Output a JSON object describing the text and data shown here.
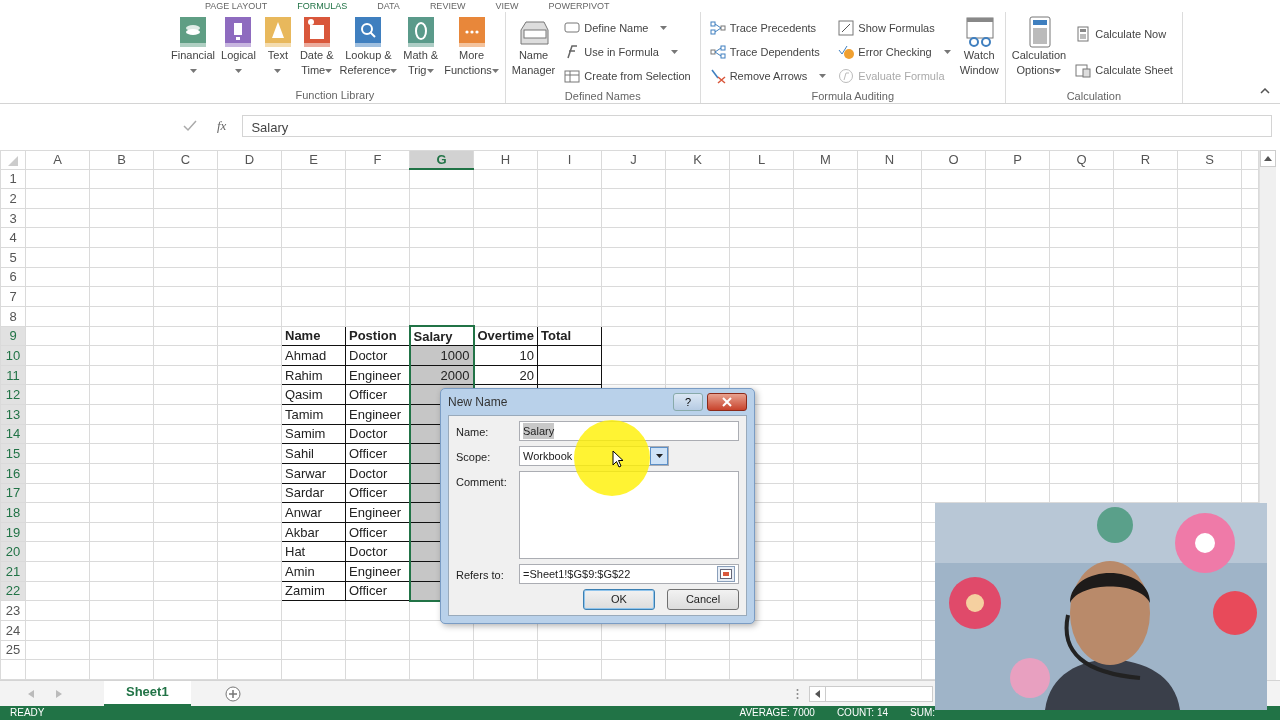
{
  "ribbon_tabs": [
    {
      "label": "PAGE LAYOUT",
      "selected": false
    },
    {
      "label": "FORMULAS",
      "selected": true
    },
    {
      "label": "DATA",
      "selected": false
    },
    {
      "label": "REVIEW",
      "selected": false
    },
    {
      "label": "VIEW",
      "selected": false
    },
    {
      "label": "POWERPIVOT",
      "selected": false
    }
  ],
  "ribbon_groups": [
    {
      "title": "Function Library",
      "items": [
        {
          "kind": "large",
          "label": "Financial",
          "dropdown": true,
          "disabled": false
        },
        {
          "kind": "large",
          "label": "Logical",
          "dropdown": true,
          "disabled": false
        },
        {
          "kind": "large",
          "label": "Text",
          "dropdown": true,
          "disabled": false
        },
        {
          "kind": "large",
          "label": "Date &\nTime",
          "dropdown": true,
          "disabled": false
        },
        {
          "kind": "large",
          "label": "Lookup &\nReference",
          "dropdown": true,
          "disabled": false
        },
        {
          "kind": "large",
          "label": "Math &\nTrig",
          "dropdown": true,
          "disabled": false
        },
        {
          "kind": "large",
          "label": "More\nFunctions",
          "dropdown": true,
          "disabled": false
        }
      ]
    },
    {
      "title": "Defined Names",
      "items": [
        {
          "kind": "large",
          "label": "Name\nManager",
          "dropdown": false,
          "disabled": false
        },
        {
          "kind": "small",
          "label": "Define Name",
          "dropdown": true,
          "disabled": false
        },
        {
          "kind": "small",
          "label": "Use in Formula",
          "dropdown": true,
          "disabled": false
        },
        {
          "kind": "small",
          "label": "Create from Selection",
          "dropdown": false,
          "disabled": false
        }
      ]
    },
    {
      "title": "Formula Auditing",
      "items": [
        {
          "kind": "small",
          "label": "Trace Precedents",
          "dropdown": false,
          "disabled": false
        },
        {
          "kind": "small",
          "label": "Trace Dependents",
          "dropdown": false,
          "disabled": false
        },
        {
          "kind": "small",
          "label": "Remove Arrows",
          "dropdown": true,
          "disabled": false
        },
        {
          "kind": "small",
          "label": "Show Formulas",
          "dropdown": false,
          "disabled": false
        },
        {
          "kind": "small",
          "label": "Error Checking",
          "dropdown": true,
          "disabled": false
        },
        {
          "kind": "small",
          "label": "Evaluate Formula",
          "dropdown": false,
          "disabled": true
        },
        {
          "kind": "large",
          "label": "Watch\nWindow",
          "dropdown": false,
          "disabled": false
        }
      ]
    },
    {
      "title": "Calculation",
      "items": [
        {
          "kind": "large",
          "label": "Calculation\nOptions",
          "dropdown": true,
          "disabled": false
        },
        {
          "kind": "small",
          "label": "Calculate Now",
          "dropdown": false,
          "disabled": false
        },
        {
          "kind": "small",
          "label": "Calculate Sheet",
          "dropdown": false,
          "disabled": false
        }
      ]
    }
  ],
  "formula_bar": {
    "insert_function": "fx",
    "value": "Salary"
  },
  "grid": {
    "columns": [
      {
        "label": "A",
        "selected": false
      },
      {
        "label": "B",
        "selected": false
      },
      {
        "label": "C",
        "selected": false
      },
      {
        "label": "D",
        "selected": false
      },
      {
        "label": "E",
        "selected": false
      },
      {
        "label": "F",
        "selected": false
      },
      {
        "label": "G",
        "selected": true
      },
      {
        "label": "H",
        "selected": false
      },
      {
        "label": "I",
        "selected": false
      },
      {
        "label": "J",
        "selected": false
      },
      {
        "label": "K",
        "selected": false
      },
      {
        "label": "L",
        "selected": false
      },
      {
        "label": "M",
        "selected": false
      },
      {
        "label": "N",
        "selected": false
      },
      {
        "label": "O",
        "selected": false
      },
      {
        "label": "P",
        "selected": false
      },
      {
        "label": "Q",
        "selected": false
      },
      {
        "label": "R",
        "selected": false
      },
      {
        "label": "S",
        "selected": false
      }
    ],
    "rows": [
      {
        "label": "1",
        "selected": false
      },
      {
        "label": "2",
        "selected": false
      },
      {
        "label": "3",
        "selected": false
      },
      {
        "label": "4",
        "selected": false
      },
      {
        "label": "5",
        "selected": false
      },
      {
        "label": "6",
        "selected": false
      },
      {
        "label": "7",
        "selected": false
      },
      {
        "label": "8",
        "selected": false
      },
      {
        "label": "9",
        "selected": true
      },
      {
        "label": "10",
        "selected": true
      },
      {
        "label": "11",
        "selected": true
      },
      {
        "label": "12",
        "selected": true
      },
      {
        "label": "13",
        "selected": true
      },
      {
        "label": "14",
        "selected": true
      },
      {
        "label": "15",
        "selected": true
      },
      {
        "label": "16",
        "selected": true
      },
      {
        "label": "17",
        "selected": true
      },
      {
        "label": "18",
        "selected": true
      },
      {
        "label": "19",
        "selected": true
      },
      {
        "label": "20",
        "selected": true
      },
      {
        "label": "21",
        "selected": true
      },
      {
        "label": "22",
        "selected": true
      },
      {
        "label": "23",
        "selected": false
      },
      {
        "label": "24",
        "selected": false
      },
      {
        "label": "25",
        "selected": false
      }
    ]
  },
  "table": {
    "header": [
      "Name",
      "Postion",
      "Salary",
      "Overtime",
      "Total"
    ],
    "rows": [
      [
        "Ahmad",
        "Doctor",
        "1000",
        "10",
        null
      ],
      [
        "Rahim",
        "Engineer",
        "2000",
        "20",
        null
      ],
      [
        "Qasim",
        "Officer",
        null,
        null,
        null
      ],
      [
        "Tamim",
        "Engineer",
        null,
        null,
        null
      ],
      [
        "Samim",
        "Doctor",
        null,
        null,
        null
      ],
      [
        "Sahil",
        "Officer",
        null,
        null,
        null
      ],
      [
        "Sarwar",
        "Doctor",
        null,
        null,
        null
      ],
      [
        "Sardar",
        "Officer",
        null,
        null,
        null
      ],
      [
        "Anwar",
        "Engineer",
        null,
        null,
        null
      ],
      [
        "Akbar",
        "Officer",
        null,
        null,
        null
      ],
      [
        "Hat",
        "Doctor",
        null,
        null,
        null
      ],
      [
        "Amin",
        "Engineer",
        null,
        null,
        null
      ],
      [
        "Zamim",
        "Officer",
        null,
        null,
        null
      ]
    ]
  },
  "sheet_tabs": [
    {
      "label": "Sheet1",
      "selected": true
    }
  ],
  "status_bar": {
    "mode": "READY",
    "stats": [
      "AVERAGE: 7000",
      "COUNT: 14",
      "SUM:"
    ]
  },
  "dialog": {
    "title": "New Name",
    "help": "?",
    "fields": [
      {
        "kind": "text",
        "label": "Name:",
        "value": "Salary"
      },
      {
        "kind": "select",
        "label": "Scope:",
        "value": "Workbook"
      },
      {
        "kind": "textarea",
        "label": "Comment:"
      },
      {
        "kind": "reference",
        "label": "Refers to:",
        "value": "=Sheet1!$G$9:$G$22"
      }
    ],
    "buttons": [
      {
        "label": "OK",
        "default": true
      },
      {
        "label": "Cancel",
        "default": false
      }
    ]
  }
}
